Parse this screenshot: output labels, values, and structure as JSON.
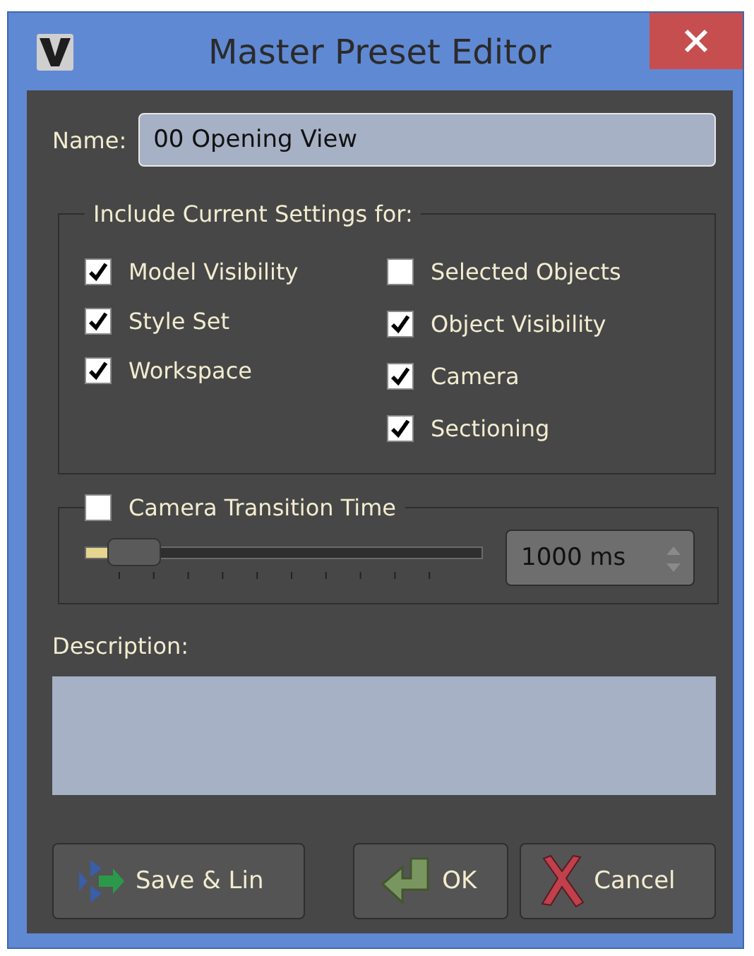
{
  "window": {
    "title": "Master Preset Editor"
  },
  "name_field": {
    "label": "Name:",
    "value": "00 Opening View"
  },
  "include_group": {
    "title": "Include Current Settings for:",
    "columns": [
      [
        {
          "label": "Model Visibility",
          "checked": true
        },
        {
          "label": "Style Set",
          "checked": true
        },
        {
          "label": "Workspace",
          "checked": true
        }
      ],
      [
        {
          "label": "Selected Objects",
          "checked": false
        },
        {
          "label": "Object Visibility",
          "checked": true
        },
        {
          "label": "Camera",
          "checked": true
        },
        {
          "label": "Sectioning",
          "checked": true
        }
      ]
    ]
  },
  "transition": {
    "label": "Camera Transition Time",
    "checked": false,
    "level": 0.12,
    "value": "1000 ms"
  },
  "description": {
    "label": "Description:"
  },
  "buttons": [
    {
      "kind": "save",
      "label": "Save & Lin"
    },
    {
      "kind": "ok",
      "label": "OK"
    },
    {
      "kind": "cancel",
      "label": "Cancel"
    }
  ]
}
